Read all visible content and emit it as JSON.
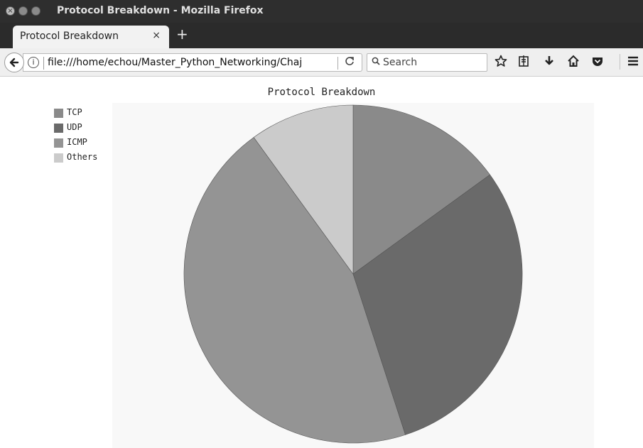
{
  "window": {
    "title": "Protocol Breakdown - Mozilla Firefox",
    "close_glyph": "×"
  },
  "tabs": [
    {
      "label": "Protocol Breakdown",
      "close_glyph": "×"
    }
  ],
  "new_tab_glyph": "+",
  "navbar": {
    "back_glyph": "←",
    "info_glyph": "i",
    "url": "file:///home/echou/Master_Python_Networking/Chaj",
    "reload_glyph": "C",
    "search_placeholder": "Search",
    "icons": [
      "bookmark-star-icon",
      "reading-list-icon",
      "downloads-icon",
      "home-icon",
      "pocket-icon",
      "menu-icon"
    ]
  },
  "colors": {
    "TCP": "#8a8a8a",
    "UDP": "#6a6a6a",
    "ICMP": "#949494",
    "Others": "#cbcbcb"
  },
  "chart_data": {
    "type": "pie",
    "title": "Protocol Breakdown",
    "categories": [
      "TCP",
      "UDP",
      "ICMP",
      "Others"
    ],
    "values": [
      15,
      30,
      45,
      10
    ],
    "legend": "top-left",
    "start_angle": "12 o'clock",
    "direction": "clockwise"
  }
}
